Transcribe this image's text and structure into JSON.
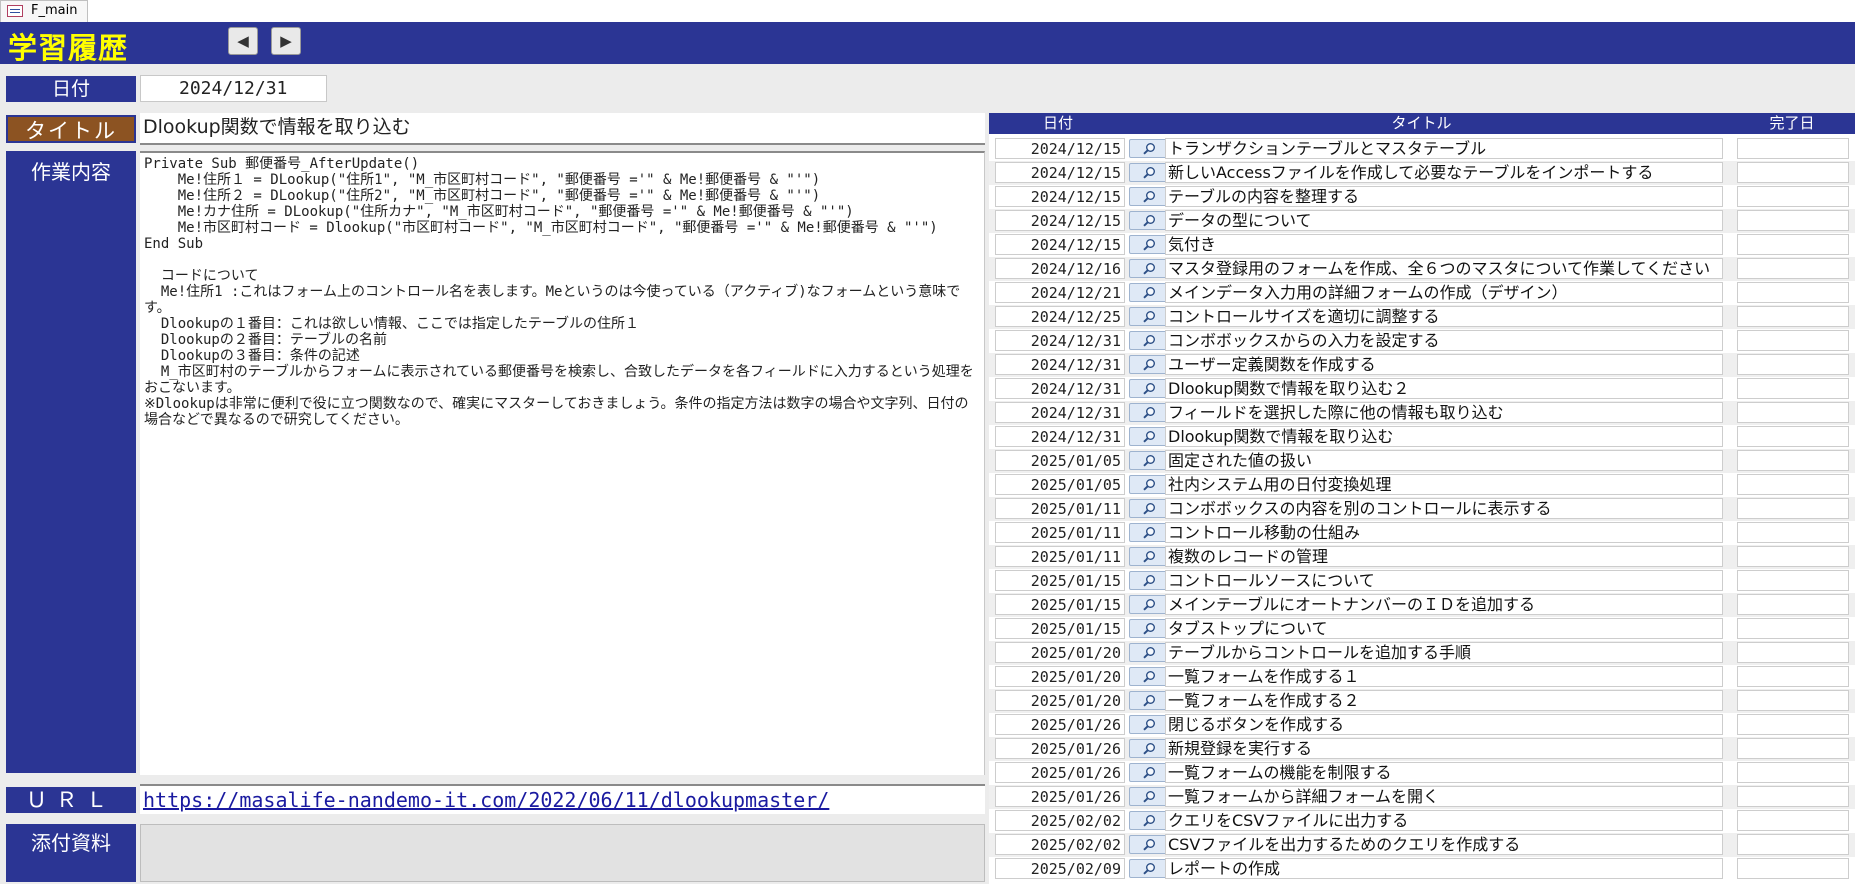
{
  "window": {
    "tab_label": "F_main"
  },
  "header": {
    "title": "学習履歴",
    "prev_glyph": "◀",
    "next_glyph": "▶"
  },
  "labels": {
    "date": "日付",
    "title": "タイトル",
    "work": "作業内容",
    "url": "ＵＲＬ",
    "attachments": "添付資料"
  },
  "record": {
    "date": "2024/12/31",
    "title": "Dlookup関数で情報を取り込む",
    "work_content": "Private Sub 郵便番号_AfterUpdate()\n    Me!住所１ = DLookup(\"住所1\", \"M_市区町村コード\", \"郵便番号 ='\" & Me!郵便番号 & \"'\")\n    Me!住所２ = DLookup(\"住所2\", \"M_市区町村コード\", \"郵便番号 ='\" & Me!郵便番号 & \"'\")\n    Me!カナ住所 = DLookup(\"住所カナ\", \"M_市区町村コード\", \"郵便番号 ='\" & Me!郵便番号 & \"'\")\n    Me!市区町村コード = Dlookup(\"市区町村コード\", \"M_市区町村コード\", \"郵便番号 ='\" & Me!郵便番号 & \"'\")\nEnd Sub\n\n  コードについて\n  Me!住所1 :これはフォーム上のコントロール名を表します。Meというのは今使っている（アクティブ)なフォームという意味です。\n  Dlookupの１番目：これは欲しい情報、ここでは指定したテーブルの住所１\n  Dlookupの２番目：テーブルの名前\n  Dlookupの３番目：条件の記述\n  M_市区町村のテーブルからフォームに表示されている郵便番号を検索し、合致したデータを各フィールドに入力するという処理をおこないます。\n※Dlookupは非常に便利で役に立つ関数なので、確実にマスターしておきましょう。条件の指定方法は数字の場合や文字列、日付の場合などで異なるので研究してください。",
    "url": "https://masalife-nandemo-it.com/2022/06/11/dlookupmaster/",
    "attachments": ""
  },
  "list": {
    "headers": {
      "date": "日付",
      "title": "タイトル",
      "done": "完了日"
    },
    "open_icon": "magnifier-icon",
    "rows": [
      {
        "date": "2024/12/15",
        "title": "トランザクションテーブルとマスタテーブル",
        "done": ""
      },
      {
        "date": "2024/12/15",
        "title": "新しいAccessファイルを作成して必要なテーブルをインポートする",
        "done": ""
      },
      {
        "date": "2024/12/15",
        "title": "テーブルの内容を整理する",
        "done": ""
      },
      {
        "date": "2024/12/15",
        "title": "データの型について",
        "done": ""
      },
      {
        "date": "2024/12/15",
        "title": "気付き",
        "done": ""
      },
      {
        "date": "2024/12/16",
        "title": "マスタ登録用のフォームを作成、全６つのマスタについて作業してください",
        "done": ""
      },
      {
        "date": "2024/12/21",
        "title": "メインデータ入力用の詳細フォームの作成（デザイン）",
        "done": ""
      },
      {
        "date": "2024/12/25",
        "title": "コントロールサイズを適切に調整する",
        "done": ""
      },
      {
        "date": "2024/12/31",
        "title": "コンボボックスからの入力を設定する",
        "done": ""
      },
      {
        "date": "2024/12/31",
        "title": "ユーザー定義関数を作成する",
        "done": ""
      },
      {
        "date": "2024/12/31",
        "title": "Dlookup関数で情報を取り込む２",
        "done": ""
      },
      {
        "date": "2024/12/31",
        "title": "フィールドを選択した際に他の情報も取り込む",
        "done": ""
      },
      {
        "date": "2024/12/31",
        "title": "Dlookup関数で情報を取り込む",
        "done": ""
      },
      {
        "date": "2025/01/05",
        "title": "固定された値の扱い",
        "done": ""
      },
      {
        "date": "2025/01/05",
        "title": "社内システム用の日付変換処理",
        "done": ""
      },
      {
        "date": "2025/01/11",
        "title": "コンボボックスの内容を別のコントロールに表示する",
        "done": ""
      },
      {
        "date": "2025/01/11",
        "title": "コントロール移動の仕組み",
        "done": ""
      },
      {
        "date": "2025/01/11",
        "title": "複数のレコードの管理",
        "done": ""
      },
      {
        "date": "2025/01/15",
        "title": "コントロールソースについて",
        "done": ""
      },
      {
        "date": "2025/01/15",
        "title": "メインテーブルにオートナンバーのＩＤを追加する",
        "done": ""
      },
      {
        "date": "2025/01/15",
        "title": "タブストップについて",
        "done": ""
      },
      {
        "date": "2025/01/20",
        "title": "テーブルからコントロールを追加する手順",
        "done": ""
      },
      {
        "date": "2025/01/20",
        "title": "一覧フォームを作成する１",
        "done": ""
      },
      {
        "date": "2025/01/20",
        "title": "一覧フォームを作成する２",
        "done": ""
      },
      {
        "date": "2025/01/26",
        "title": "閉じるボタンを作成する",
        "done": ""
      },
      {
        "date": "2025/01/26",
        "title": "新規登録を実行する",
        "done": ""
      },
      {
        "date": "2025/01/26",
        "title": "一覧フォームの機能を制限する",
        "done": ""
      },
      {
        "date": "2025/01/26",
        "title": "一覧フォームから詳細フォームを開く",
        "done": ""
      },
      {
        "date": "2025/02/02",
        "title": "クエリをCSVファイルに出力する",
        "done": ""
      },
      {
        "date": "2025/02/02",
        "title": "CSVファイルを出力するためのクエリを作成する",
        "done": ""
      },
      {
        "date": "2025/02/09",
        "title": "レポートの作成",
        "done": ""
      }
    ]
  },
  "colors": {
    "header_bg": "#2b3594",
    "title_accent": "#ffff00",
    "title_label_bg": "#8c5322"
  }
}
